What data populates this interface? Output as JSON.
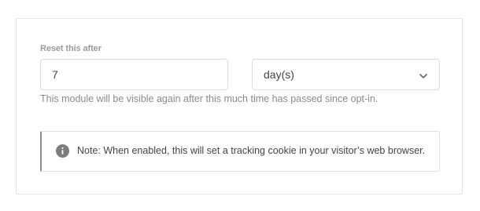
{
  "reset": {
    "label": "Reset this after",
    "amount_value": "7",
    "unit_value": "day(s)",
    "help_text": "This module will be visible again after this much time has passed since opt-in."
  },
  "notice": {
    "text": "Note: When enabled, this will set a tracking cookie in your visitor’s web browser.",
    "icon": "info-icon"
  },
  "colors": {
    "border": "#dcdcdc",
    "muted_text": "#8a8a8a",
    "notice_accent": "#8c8c8c"
  }
}
